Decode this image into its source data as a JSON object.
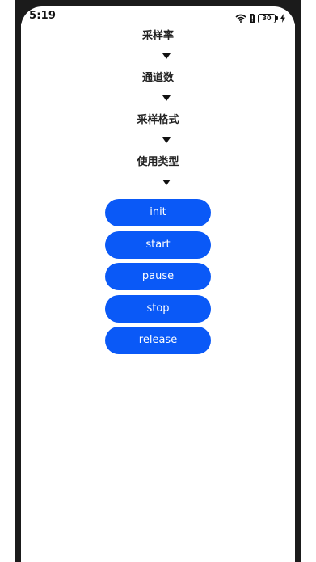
{
  "status_bar": {
    "time": "5:19",
    "battery_level": "30",
    "icons": [
      "wifi-icon",
      "sim-alert-icon",
      "battery-icon",
      "charging-icon"
    ]
  },
  "settings": [
    {
      "label": "采样率",
      "dropdown_icon": "triangle-down-icon"
    },
    {
      "label": "通道数",
      "dropdown_icon": "triangle-down-icon"
    },
    {
      "label": "采样格式",
      "dropdown_icon": "triangle-down-icon"
    },
    {
      "label": "使用类型",
      "dropdown_icon": "triangle-down-icon"
    }
  ],
  "buttons": {
    "init": "init",
    "start": "start",
    "pause": "pause",
    "stop": "stop",
    "release": "release"
  },
  "colors": {
    "button_bg": "#0a59f7",
    "button_text": "#ffffff",
    "bezel": "#1b1b1b"
  }
}
